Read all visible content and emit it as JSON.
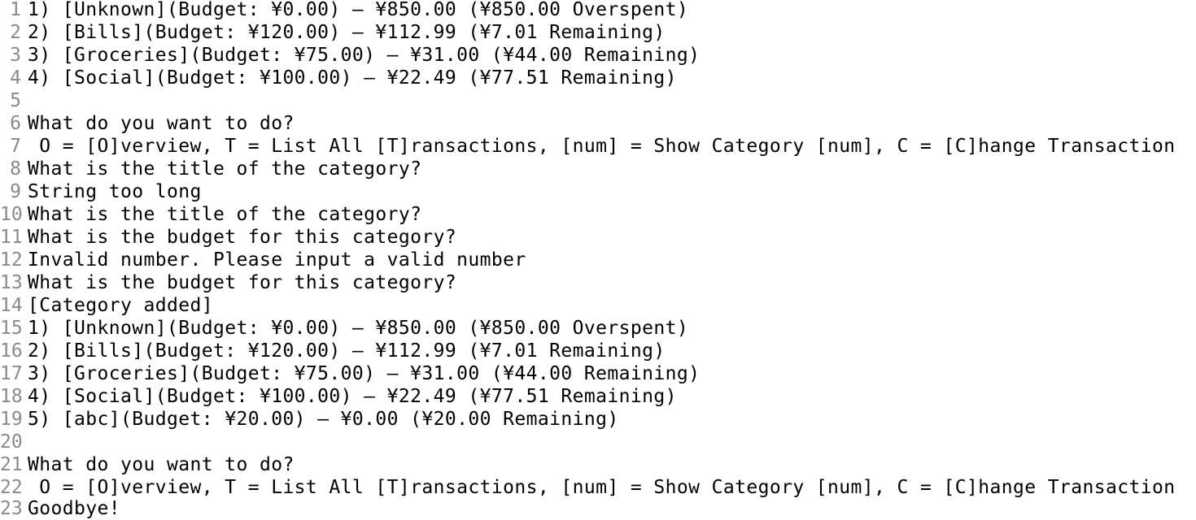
{
  "colors": {
    "background": "#ffffff",
    "text": "#000000",
    "line_number": "#8a8a8a"
  },
  "lines": [
    {
      "num": "1",
      "text": "1) [Unknown](Budget: ¥0.00) — ¥850.00 (¥850.00 Overspent)"
    },
    {
      "num": "2",
      "text": "2) [Bills](Budget: ¥120.00) — ¥112.99 (¥7.01 Remaining)"
    },
    {
      "num": "3",
      "text": "3) [Groceries](Budget: ¥75.00) — ¥31.00 (¥44.00 Remaining)"
    },
    {
      "num": "4",
      "text": "4) [Social](Budget: ¥100.00) — ¥22.49 (¥77.51 Remaining)"
    },
    {
      "num": "5",
      "text": ""
    },
    {
      "num": "6",
      "text": "What do you want to do?"
    },
    {
      "num": "7",
      "text": " O = [O]verview, T = List All [T]ransactions, [num] = Show Category [num], C = [C]hange Transaction"
    },
    {
      "num": "8",
      "text": "What is the title of the category?"
    },
    {
      "num": "9",
      "text": "String too long"
    },
    {
      "num": "10",
      "text": "What is the title of the category?"
    },
    {
      "num": "11",
      "text": "What is the budget for this category?"
    },
    {
      "num": "12",
      "text": "Invalid number. Please input a valid number"
    },
    {
      "num": "13",
      "text": "What is the budget for this category?"
    },
    {
      "num": "14",
      "text": "[Category added]"
    },
    {
      "num": "15",
      "text": "1) [Unknown](Budget: ¥0.00) — ¥850.00 (¥850.00 Overspent)"
    },
    {
      "num": "16",
      "text": "2) [Bills](Budget: ¥120.00) — ¥112.99 (¥7.01 Remaining)"
    },
    {
      "num": "17",
      "text": "3) [Groceries](Budget: ¥75.00) — ¥31.00 (¥44.00 Remaining)"
    },
    {
      "num": "18",
      "text": "4) [Social](Budget: ¥100.00) — ¥22.49 (¥77.51 Remaining)"
    },
    {
      "num": "19",
      "text": "5) [abc](Budget: ¥20.00) — ¥0.00 (¥20.00 Remaining)"
    },
    {
      "num": "20",
      "text": ""
    },
    {
      "num": "21",
      "text": "What do you want to do?"
    },
    {
      "num": "22",
      "text": " O = [O]verview, T = List All [T]ransactions, [num] = Show Category [num], C = [C]hange Transaction"
    },
    {
      "num": "23",
      "text": "Goodbye!"
    }
  ]
}
